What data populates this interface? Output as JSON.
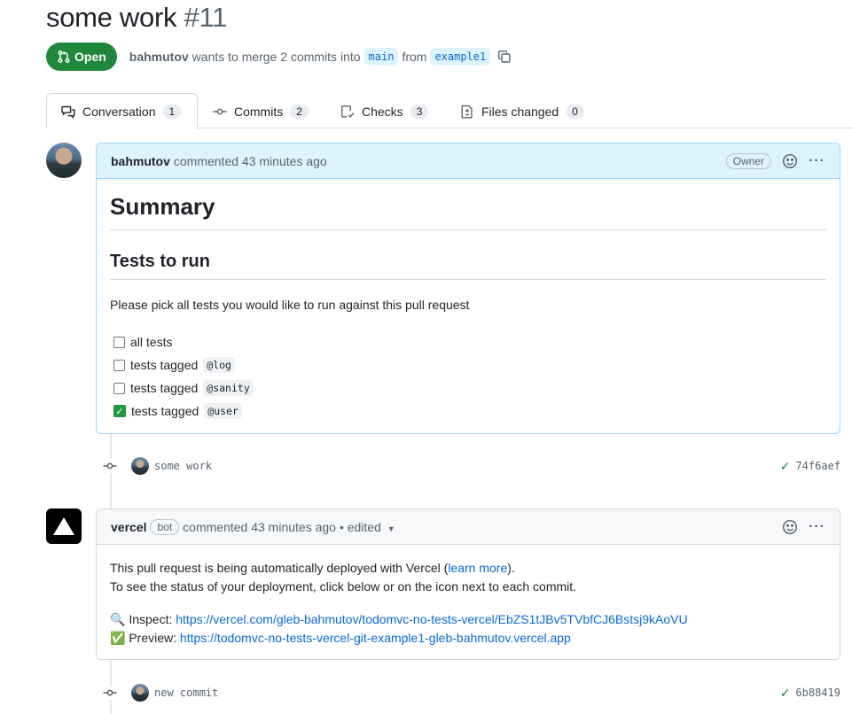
{
  "pr": {
    "title": "some work",
    "number": "#11",
    "state": "Open",
    "author": "bahmutov",
    "merge_text": "wants to merge 2 commits into",
    "base_branch": "main",
    "from_text": "from",
    "head_branch": "example1"
  },
  "tabs": [
    {
      "label": "Conversation",
      "count": "1",
      "icon": "comment-discussion-icon"
    },
    {
      "label": "Commits",
      "count": "2",
      "icon": "git-commit-icon"
    },
    {
      "label": "Checks",
      "count": "3",
      "icon": "checklist-icon"
    },
    {
      "label": "Files changed",
      "count": "0",
      "icon": "file-diff-icon"
    }
  ],
  "comment1": {
    "author": "bahmutov",
    "meta": "commented 43 minutes ago",
    "badge": "Owner",
    "heading1": "Summary",
    "heading2": "Tests to run",
    "paragraph": "Please pick all tests you would like to run against this pull request",
    "tasks": [
      {
        "text": "all tests",
        "code": "",
        "checked": false
      },
      {
        "text": "tests tagged",
        "code": "@log",
        "checked": false
      },
      {
        "text": "tests tagged",
        "code": "@sanity",
        "checked": false
      },
      {
        "text": "tests tagged",
        "code": "@user",
        "checked": true
      }
    ]
  },
  "commits": [
    {
      "message": "some work",
      "sha": "74f6aef"
    },
    {
      "message": "new commit",
      "sha": "6b88419"
    }
  ],
  "comment2": {
    "author": "vercel",
    "badge": "bot",
    "meta": "commented 43 minutes ago",
    "edited": "• edited",
    "line1_pre": "This pull request is being automatically deployed with Vercel (",
    "line1_link": "learn more",
    "line1_post": ").",
    "line2": "To see the status of your deployment, click below or on the icon next to each commit.",
    "inspect_emoji": "🔍",
    "inspect_label": "Inspect:",
    "inspect_url": "https://vercel.com/gleb-bahmutov/todomvc-no-tests-vercel/EbZS1tJBv5TVbfCJ6Bstsj9kAoVU",
    "preview_emoji": "✅",
    "preview_label": "Preview:",
    "preview_url": "https://todomvc-no-tests-vercel-git-example1-gleb-bahmutov.vercel.app"
  },
  "colors": {
    "open_green": "#1f883d",
    "link_blue": "#0969da",
    "owner_header_bg": "#ddf4ff",
    "check_green": "#1a7f37"
  }
}
